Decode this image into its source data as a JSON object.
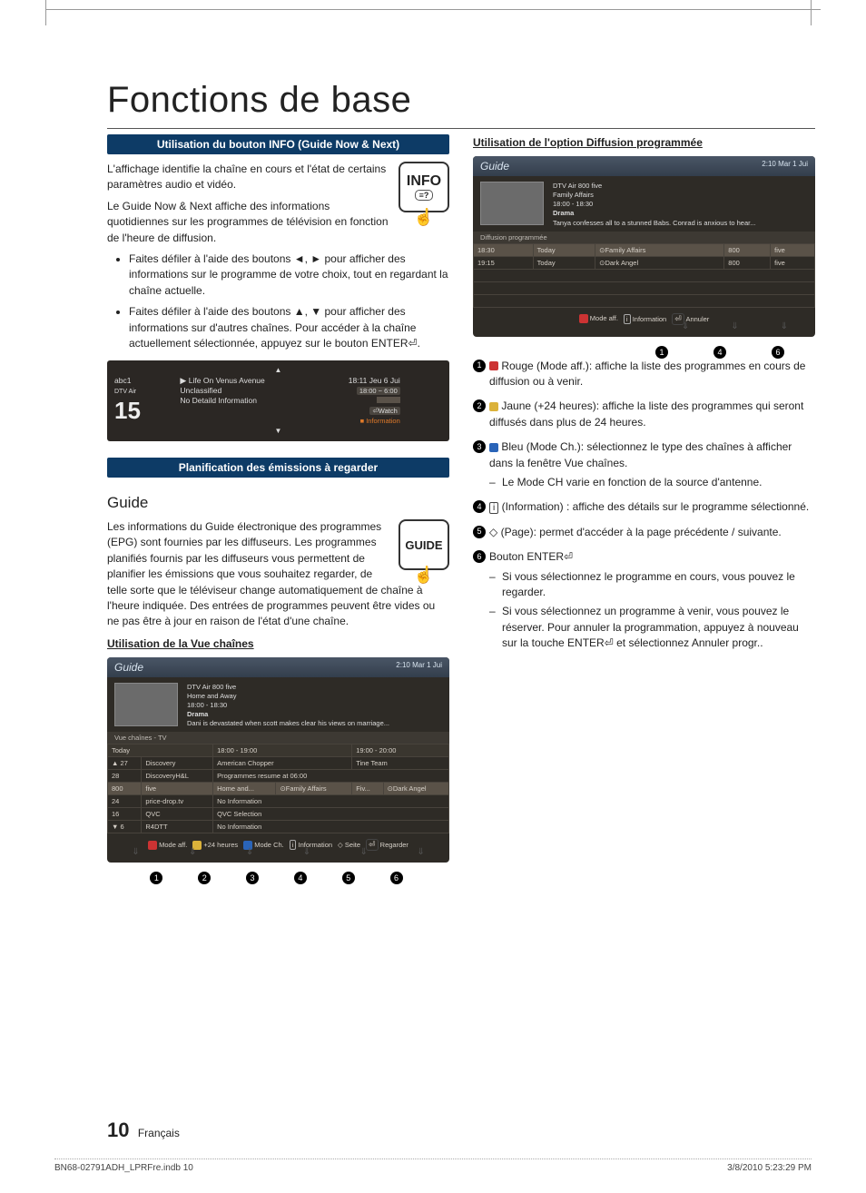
{
  "page_title": "Fonctions de base",
  "section_info_bar": "Utilisation du bouton INFO (Guide Now & Next)",
  "section_plan_bar": "Planification des émissions à regarder",
  "info_icon_label": "INFO",
  "guide_icon_label": "GUIDE",
  "info_para1": "L'affichage identifie la chaîne en cours et l'état de certains paramètres audio et vidéo.",
  "info_para2": "Le Guide Now & Next affiche des informations quotidiennes sur les programmes de télévision en fonction de l'heure de diffusion.",
  "info_bullets": [
    "Faites défiler à l'aide des boutons ◄, ► pour afficher des informations sur le programme de votre choix, tout en regardant la chaîne actuelle.",
    "Faites défiler à l'aide des boutons ▲, ▼ pour afficher des informations sur d'autres chaînes. Pour accéder à la chaîne actuellement sélectionnée, appuyez sur le bouton ENTER⏎."
  ],
  "info_panel": {
    "channel_name": "abc1",
    "service": "DTV Air",
    "channel_number": "15",
    "program": "Life On Venus Avenue",
    "class": "Unclassified",
    "detail": "No Detaild Information",
    "clock": "18:11 Jeu 6 Jui",
    "time_range": "18:00 ~ 6:00",
    "watch_label": "⏎Watch",
    "information_label": "Information"
  },
  "guide_heading": "Guide",
  "guide_para": "Les informations du Guide électronique des programmes (EPG) sont fournies par les diffuseurs. Les programmes planifiés fournis par les diffuseurs vous permettent de planifier les émissions que vous souhaitez regarder, de telle sorte que le téléviseur change automatiquement de chaîne à l'heure indiquée. Des entrées de programmes peuvent être vides ou ne pas être à jour en raison de l'état d'une chaîne.",
  "vue_chaines_title": "Utilisation de la Vue chaînes",
  "guide_box1": {
    "title": "Guide",
    "clock": "2:10 Mar 1 Jui",
    "meta_lines": [
      "DTV Air 800 five",
      "Home and Away",
      "18:00 - 18:30",
      "Drama",
      "Dani is devastated when scott makes clear his views on marriage..."
    ],
    "section_label": "Vue chaînes - TV",
    "cols": [
      "Today",
      "18:00 - 19:00",
      "19:00 - 20:00"
    ],
    "rows": [
      {
        "ch": "▲ 27",
        "name": "Discovery",
        "c1": "American Chopper",
        "c2": "Tine Team"
      },
      {
        "ch": "28",
        "name": "DiscoveryH&L",
        "c1_span": "Programmes resume at 06:00"
      },
      {
        "ch": "800",
        "name": "five",
        "c1a": "Home and...",
        "c1b": "⊙Family Affairs",
        "c2a": "Fiv...",
        "c2b": "⊙Dark Angel"
      },
      {
        "ch": "24",
        "name": "price-drop.tv",
        "c1_span": "No Information"
      },
      {
        "ch": "16",
        "name": "QVC",
        "c1_span": "QVC Selection"
      },
      {
        "ch": "▼ 6",
        "name": "R4DTT",
        "c1_span": "No Information"
      }
    ],
    "legend": [
      "Mode aff.",
      "+24 heures",
      "Mode Ch.",
      "Information",
      "Seite",
      "Regarder"
    ]
  },
  "diff_prog_title": "Utilisation de l'option Diffusion programmée",
  "guide_box2": {
    "title": "Guide",
    "clock": "2:10 Mar 1 Jui",
    "meta_lines": [
      "DTV Air 800 five",
      "Family Affairs",
      "18:00 - 18:30",
      "Drama",
      "Tanya confesses all to a stunned Babs. Conrad is anxious to hear..."
    ],
    "section_label": "Diffusion programmée",
    "rows": [
      {
        "t": "18:30",
        "d": "Today",
        "p": "⊙Family Affairs",
        "ch": "800",
        "n": "five"
      },
      {
        "t": "19:15",
        "d": "Today",
        "p": "⊙Dark Angel",
        "ch": "800",
        "n": "five"
      }
    ],
    "legend": [
      "Mode aff.",
      "Information",
      "Annuler"
    ]
  },
  "key_items": [
    {
      "n": "1",
      "badge": "red",
      "lead": "Rouge (Mode aff.):",
      "text": " affiche la liste des programmes en cours de diffusion ou à venir."
    },
    {
      "n": "2",
      "badge": "yel",
      "lead": "Jaune (+24 heures):",
      "text": " affiche la liste des programmes qui seront diffusés dans plus de 24 heures."
    },
    {
      "n": "3",
      "badge": "blu",
      "lead": "Bleu (Mode Ch.):",
      "text": " sélectionnez le type des chaînes à afficher dans la fenêtre Vue chaînes.",
      "sub": "Le Mode CH varie en fonction de la source d'antenne."
    },
    {
      "n": "4",
      "icon": "i",
      "lead": "(Information)",
      "text": " : affiche des détails sur le programme sélectionné."
    },
    {
      "n": "5",
      "icon": "updown",
      "lead": "(Page):",
      "text": " permet d'accéder à la page précédente / suivante."
    },
    {
      "n": "6",
      "lead": "Bouton ENTER⏎",
      "text": "",
      "subs": [
        "Si vous sélectionnez le programme en cours, vous pouvez le regarder.",
        "Si vous sélectionnez un programme à venir, vous pouvez le réserver. Pour annuler la programmation, appuyez à nouveau sur la touche ENTER⏎ et sélectionnez Annuler progr.."
      ]
    }
  ],
  "footer_page": "10",
  "footer_lang": "Français",
  "print_left": "BN68-02791ADH_LPRFre.indb   10",
  "print_right": "3/8/2010   5:23:29 PM"
}
